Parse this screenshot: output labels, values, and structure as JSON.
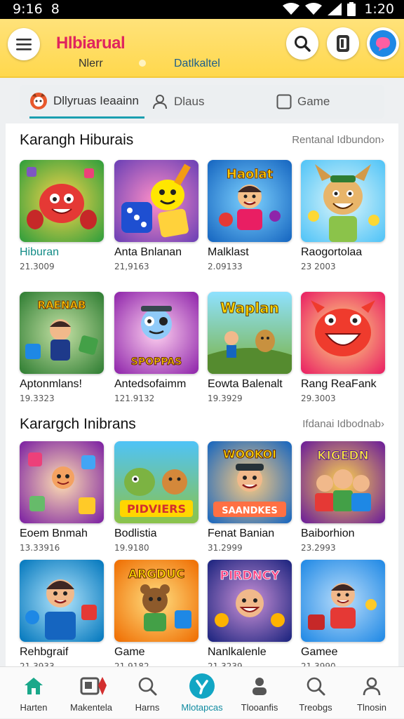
{
  "status_bar": {
    "time": "9:16",
    "notification": "8",
    "clock": "1:20"
  },
  "header": {
    "title": "Hlbiarual",
    "sub_left": "Nlerr",
    "sub_right": "Datlkaltel",
    "icons": [
      "menu-icon",
      "search-icon",
      "document-icon",
      "chat-icon"
    ]
  },
  "filter_tabs": [
    {
      "label": "Dllyruas Ieaainn",
      "icon": "avatar-icon",
      "active": true
    },
    {
      "label": "Dlaus",
      "icon": "user-icon",
      "active": false
    },
    {
      "label": "Game",
      "icon": "checkbox-icon",
      "active": false
    }
  ],
  "sections": [
    {
      "title": "Karangh Hiburais",
      "link": "Rentanal Idbundon›",
      "items": [
        {
          "name": "Hiburan",
          "meta": "21.3009"
        },
        {
          "name": "Anta Bnlanan",
          "meta": "21,9163"
        },
        {
          "name": "Malklast",
          "meta": "2.09133"
        },
        {
          "name": "Raogortolaa",
          "meta": "23 2003"
        },
        {
          "name": "Aptonmlans!",
          "meta": "19.3323"
        },
        {
          "name": "Antedsofaimm",
          "meta": "121.9132"
        },
        {
          "name": "Eowta Balenalt",
          "meta": "19.3929"
        },
        {
          "name": "Rang ReaFank",
          "meta": "29.3003"
        }
      ]
    },
    {
      "title": "Karargch Inibrans",
      "link": "Ifdanai Idbodnab›",
      "items": [
        {
          "name": "Eoem Bnmah",
          "meta": "13.33916"
        },
        {
          "name": "Bodlistia",
          "meta": "19.9180"
        },
        {
          "name": "Fenat Banian",
          "meta": "31.2999"
        },
        {
          "name": "Baiborhion",
          "meta": "23.2993"
        },
        {
          "name": "Rehbgraif",
          "meta": "21.3933"
        },
        {
          "name": "Game",
          "meta": "21.9182"
        },
        {
          "name": "Nanlkalenle",
          "meta": "21.3239"
        },
        {
          "name": "Gamee",
          "meta": "21.3990"
        }
      ]
    }
  ],
  "thumb_text": {
    "t3": "Haolat",
    "t5": "RAENAB",
    "t6": "SPOPPAS",
    "t7": "Waplan",
    "t10": "PIDVIERS",
    "t11a": "WOOKOI",
    "t11b": "SAANDKES",
    "t12": "KIGEDN",
    "t14": "ARGDUC",
    "t15": "PIRDNCY"
  },
  "bottom_nav": [
    {
      "label": "Harten",
      "icon": "home-icon",
      "active": false
    },
    {
      "label": "Makentela",
      "icon": "store-icon",
      "active": false
    },
    {
      "label": "Harns",
      "icon": "search-icon",
      "active": false
    },
    {
      "label": "Mlotapcas",
      "icon": "app-logo-icon",
      "active": true
    },
    {
      "label": "Tlooanfis",
      "icon": "user-icon",
      "active": false
    },
    {
      "label": "Treobgs",
      "icon": "search-icon",
      "active": false
    },
    {
      "label": "Tlnosin",
      "icon": "profile-icon",
      "active": false
    }
  ],
  "colors": {
    "header_bg": "#ffd84d",
    "title_pink": "#e0245e",
    "accent_teal": "#1a9fb0",
    "active_nav": "#0f8aa0"
  }
}
